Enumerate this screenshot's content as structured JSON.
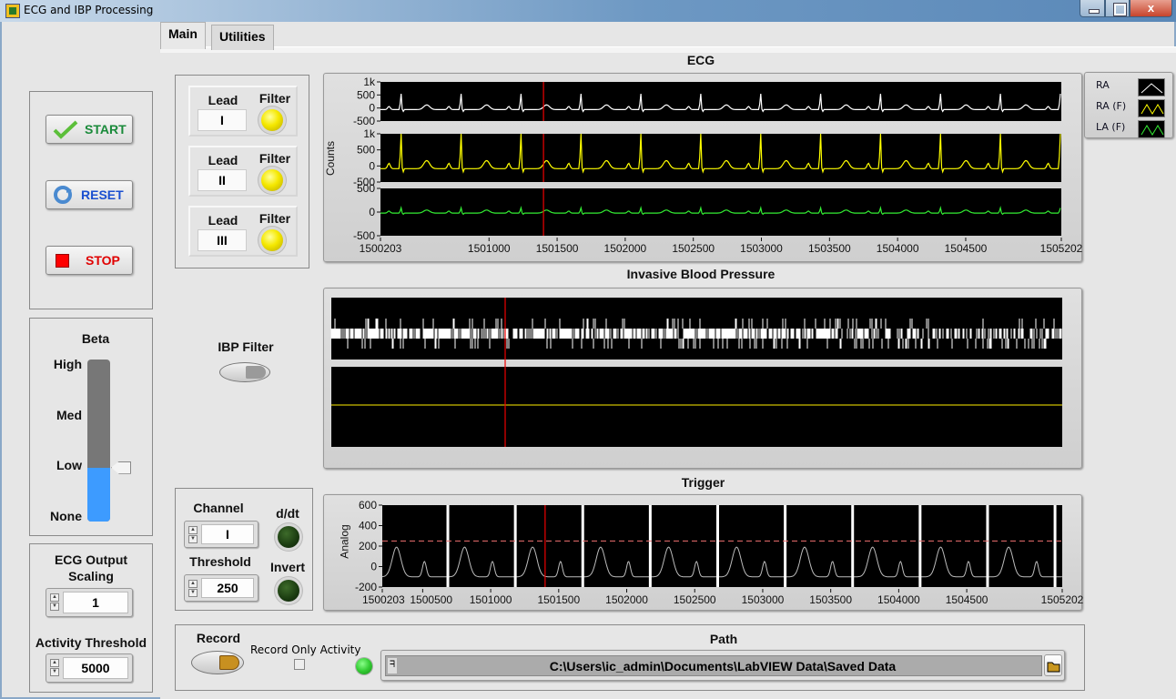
{
  "window": {
    "title": "ECG and IBP Processing",
    "close_glyph": "x"
  },
  "tabs": [
    {
      "label": "Main",
      "active": true
    },
    {
      "label": "Utilities",
      "active": false
    }
  ],
  "controls": {
    "start_label": "START",
    "reset_label": "RESET",
    "stop_label": "STOP",
    "colors": {
      "start": "#1a8a3a",
      "reset": "#1a4fd0",
      "stop": "#e00000"
    }
  },
  "beta": {
    "label": "Beta",
    "levels": [
      "High",
      "Med",
      "Low",
      "None"
    ],
    "selected": "Low",
    "fill_fraction": 0.333
  },
  "scaling": {
    "ecg_output_label_line1": "ECG Output",
    "ecg_output_label_line2": "Scaling",
    "ecg_output_value": "1",
    "activity_threshold_label": "Activity Threshold",
    "activity_threshold_value": "5000"
  },
  "leads": [
    {
      "lead_label": "Lead",
      "filter_label": "Filter",
      "value": "I",
      "filter_on": true
    },
    {
      "lead_label": "Lead",
      "filter_label": "Filter",
      "value": "II",
      "filter_on": true
    },
    {
      "lead_label": "Lead",
      "filter_label": "Filter",
      "value": "III",
      "filter_on": true
    }
  ],
  "ecg_graph": {
    "title": "ECG",
    "ylabel": "Counts",
    "plots": [
      {
        "name": "RA",
        "color": "#ffffff",
        "yticks": [
          "1k",
          "500",
          "0",
          "-500"
        ]
      },
      {
        "name": "RA (F)",
        "color": "#ffff00",
        "yticks": [
          "1k",
          "500",
          "0",
          "-500"
        ]
      },
      {
        "name": "LA (F)",
        "color": "#33ee33",
        "yticks": [
          "500",
          "0",
          "-500"
        ]
      }
    ],
    "xticks": [
      "1500203",
      "1501000",
      "1501500",
      "1502000",
      "1502500",
      "1503000",
      "1503500",
      "1504000",
      "1504500",
      "1505202"
    ],
    "cursor_x": 1501400
  },
  "legend": [
    {
      "label": "RA",
      "color": "#ffffff"
    },
    {
      "label": "RA (F)",
      "color": "#ffff00"
    },
    {
      "label": "LA (F)",
      "color": "#33ee33"
    }
  ],
  "ibp": {
    "title": "Invasive Blood Pressure",
    "filter_label": "IBP Filter",
    "trace_colors": [
      "#ffffff",
      "#ffee00"
    ]
  },
  "trigger": {
    "title": "Trigger",
    "ylabel": "Analog",
    "yticks": [
      "600",
      "400",
      "200",
      "0",
      "-200"
    ],
    "xticks": [
      "1500203",
      "1500500",
      "1501000",
      "1501500",
      "1502000",
      "1502500",
      "1503000",
      "1503500",
      "1504000",
      "1504500",
      "1505202"
    ],
    "threshold_line": 250,
    "ylim": [
      -200,
      600
    ],
    "channel_label": "Channel",
    "channel_value": "I",
    "threshold_label": "Threshold",
    "threshold_value": "250",
    "ddt_label": "d/dt",
    "invert_label": "Invert"
  },
  "record": {
    "record_label": "Record",
    "record_only_activity_label": "Record Only Activity",
    "record_only_activity_checked": false,
    "path_label": "Path",
    "path_value": "C:\\Users\\ic_admin\\Documents\\LabVIEW Data\\Saved Data",
    "status_led_color": "#33cc33"
  }
}
